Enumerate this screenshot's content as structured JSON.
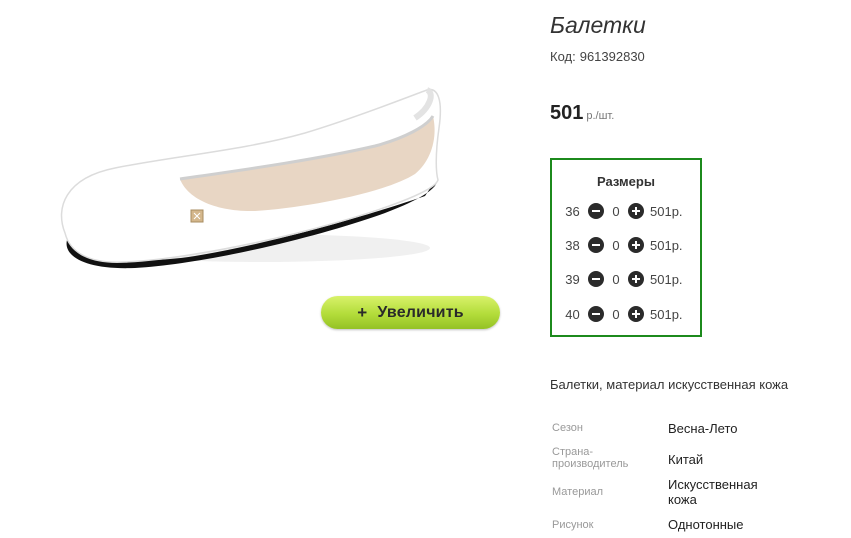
{
  "product": {
    "title": "Балетки",
    "code_label": "Код:",
    "code_value": "961392830",
    "price_amount": "501",
    "price_unit": "р./шт.",
    "zoom_label": "Увеличить",
    "zoom_icon": "+"
  },
  "sizes": {
    "title": "Размеры",
    "rows": [
      {
        "size": "36",
        "qty": "0",
        "price": "501р."
      },
      {
        "size": "38",
        "qty": "0",
        "price": "501р."
      },
      {
        "size": "39",
        "qty": "0",
        "price": "501р."
      },
      {
        "size": "40",
        "qty": "0",
        "price": "501р."
      }
    ]
  },
  "description": "Балетки, материал искусственная кожа",
  "properties": [
    {
      "label": "Сезон",
      "value": "Весна-Лето"
    },
    {
      "label": "Страна-производитель",
      "value": "Китай"
    },
    {
      "label": "Материал",
      "value": "Искусственная кожа"
    },
    {
      "label": "Рисунок",
      "value": "Однотонные"
    }
  ],
  "colors": {
    "accent_border": "#1c8a1c",
    "zoom_button": "#b3dc3a",
    "circle_button": "#2b2b2b"
  },
  "icons": {
    "minus": "minus-circle-icon",
    "plus": "plus-circle-icon"
  }
}
